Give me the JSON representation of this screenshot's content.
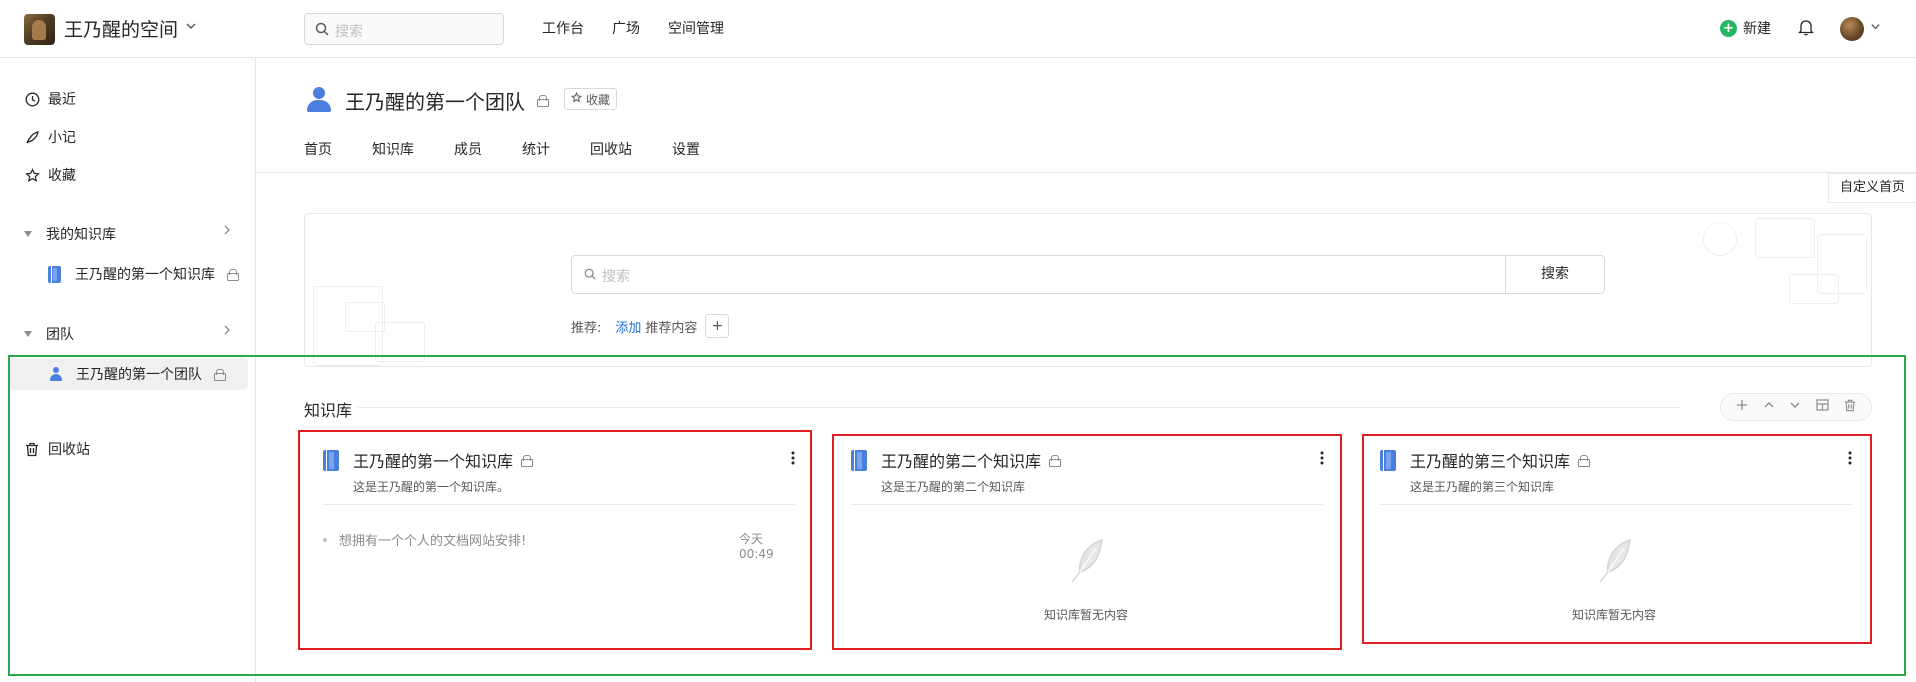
{
  "header": {
    "space_name": "王乃醒的空间",
    "search_placeholder": "搜索",
    "nav": [
      "工作台",
      "广场",
      "空间管理"
    ],
    "new_label": "新建"
  },
  "sidebar": {
    "items": [
      "最近",
      "小记",
      "收藏"
    ],
    "my_kb_group": "我的知识库",
    "my_kb_item": "王乃醒的第一个知识库",
    "team_group": "团队",
    "team_item": "王乃醒的第一个团队",
    "trash": "回收站"
  },
  "team": {
    "title": "王乃醒的第一个团队",
    "favorite_label": "收藏",
    "tabs": [
      "首页",
      "知识库",
      "成员",
      "统计",
      "回收站",
      "设置"
    ],
    "customize_label": "自定义首页"
  },
  "search_panel": {
    "placeholder": "搜索",
    "button": "搜索",
    "recommend_label": "推荐:",
    "add_link": "添加",
    "recommend_rest": "推荐内容"
  },
  "kb_section": {
    "title": "知识库",
    "cards": [
      {
        "name": "王乃醒的第一个知识库",
        "desc": "这是王乃醒的第一个知识库。",
        "doc_title": "想拥有一个个人的文档网站安排!",
        "doc_time": "今天 00:49"
      },
      {
        "name": "王乃醒的第二个知识库",
        "desc": "这是王乃醒的第二个知识库",
        "empty_text": "知识库暂无内容"
      },
      {
        "name": "王乃醒的第三个知识库",
        "desc": "这是王乃醒的第三个知识库",
        "empty_text": "知识库暂无内容"
      }
    ]
  },
  "colors": {
    "accent_blue": "#4a7fe0",
    "link_blue": "#1f6fe0",
    "new_green": "#25b864",
    "annotation_green": "#2aa84a",
    "annotation_red": "#e02020"
  }
}
